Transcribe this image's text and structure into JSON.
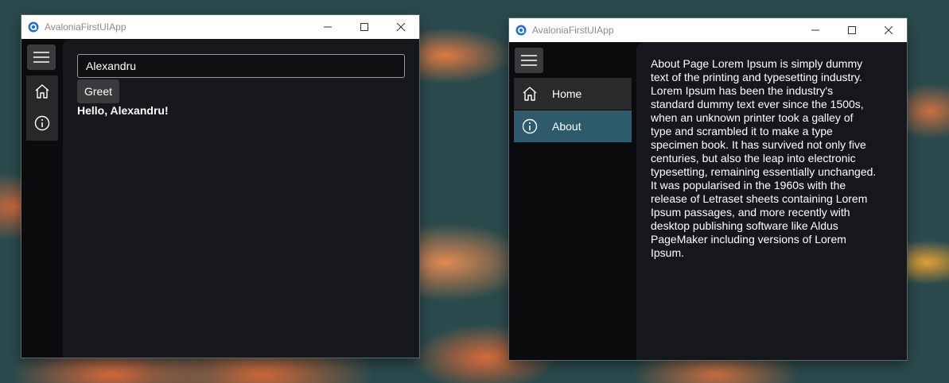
{
  "window_left": {
    "title": "AvaloniaFirstUIApp",
    "name_input": {
      "value": "Alexandru"
    },
    "greet_label": "Greet",
    "greeting": "Hello, Alexandru!"
  },
  "window_right": {
    "title": "AvaloniaFirstUIApp",
    "nav": [
      {
        "label": "Home",
        "icon": "home-icon",
        "selected": false
      },
      {
        "label": "About",
        "icon": "info-icon",
        "selected": true
      }
    ],
    "about_lines": [
      "About Page Lorem Ipsum is simply dummy",
      "text of the printing and typesetting industry.",
      "Lorem Ipsum has been the industry's",
      "standard dummy text ever since the 1500s,",
      "when an unknown printer took a galley of",
      "type and scrambled it to make a type",
      "specimen book. It has survived not only five",
      "centuries, but also the leap into electronic",
      "typesetting, remaining essentially unchanged.",
      "It was popularised in the 1960s with the",
      "release of Letraset sheets containing Lorem",
      "Ipsum passages, and more recently with",
      "desktop publishing software like Aldus",
      "PageMaker including versions of Lorem",
      "Ipsum."
    ]
  },
  "colors": {
    "titlebar": "#ffffff",
    "window_bg": "#121316",
    "nav_selected": "#2e5b6b",
    "nav_hover": "#2a2a2d",
    "accent_icon": "#1e6fd9"
  }
}
